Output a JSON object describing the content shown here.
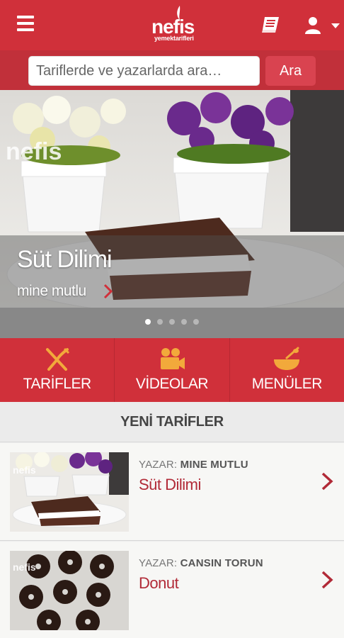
{
  "header": {
    "logo_main": "nefis",
    "logo_sub": "yemektarifleri",
    "icons": [
      "menu-icon",
      "logo",
      "book-icon",
      "user-icon",
      "caret-down-icon"
    ]
  },
  "search": {
    "placeholder": "Tariflerde ve yazarlarda ara…",
    "button_label": "Ara"
  },
  "hero": {
    "title": "Süt Dilimi",
    "author": "mine mutlu",
    "watermark": "nefis",
    "slide_count": 5,
    "active_slide": 1
  },
  "categories": [
    {
      "label": "TARİFLER",
      "icon": "fork-knife-icon"
    },
    {
      "label": "VİDEOLAR",
      "icon": "video-camera-icon"
    },
    {
      "label": "MENÜLER",
      "icon": "bowl-whisk-icon"
    }
  ],
  "section": {
    "title": "YENİ TARİFLER"
  },
  "recipes": [
    {
      "author_prefix": "YAZAR:",
      "author": "MINE MUTLU",
      "title": "Süt Dilimi",
      "thumb_watermark": "nefis"
    },
    {
      "author_prefix": "YAZAR:",
      "author": "CANSIN TORUN",
      "title": "Donut",
      "thumb_watermark": "nefis"
    }
  ],
  "colors": {
    "brand_red": "#d0303a",
    "search_bar": "#c1303a",
    "recipe_title": "#b12a37",
    "icon_orange": "#f2a93b"
  }
}
